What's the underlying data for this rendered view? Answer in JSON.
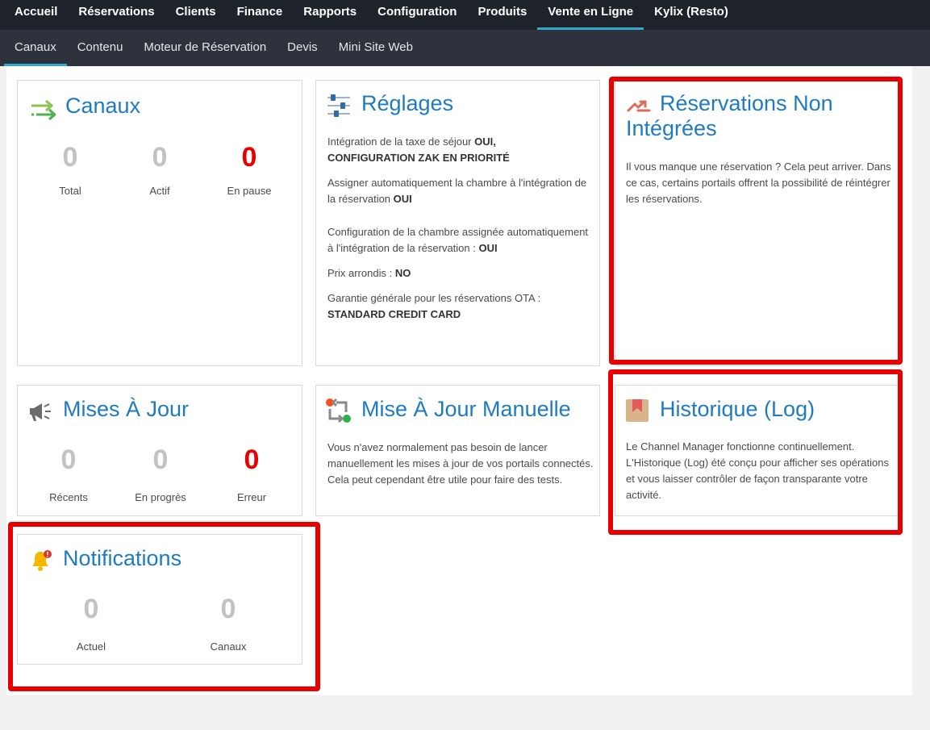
{
  "top_nav": [
    {
      "label": "Accueil",
      "active": false
    },
    {
      "label": "Réservations",
      "active": false
    },
    {
      "label": "Clients",
      "active": false
    },
    {
      "label": "Finance",
      "active": false
    },
    {
      "label": "Rapports",
      "active": false
    },
    {
      "label": "Configuration",
      "active": false
    },
    {
      "label": "Produits",
      "active": false
    },
    {
      "label": "Vente en Ligne",
      "active": true
    },
    {
      "label": "Kylix (Resto)",
      "active": false
    }
  ],
  "sub_nav": [
    {
      "label": "Canaux",
      "active": true
    },
    {
      "label": "Contenu",
      "active": false
    },
    {
      "label": "Moteur de Réservation",
      "active": false
    },
    {
      "label": "Devis",
      "active": false
    },
    {
      "label": "Mini Site Web",
      "active": false
    }
  ],
  "canaux": {
    "title": "Canaux",
    "icon": "arrows-transfer-icon",
    "stats": [
      {
        "value": "0",
        "label": "Total"
      },
      {
        "value": "0",
        "label": "Actif"
      },
      {
        "value": "0",
        "label": "En pause"
      }
    ]
  },
  "reglages": {
    "title": "Réglages",
    "icon": "sliders-icon",
    "settings": [
      {
        "text": "Intégration de la taxe de séjour ",
        "value": "OUI,",
        "value2": "CONFIGURATION ZAK EN PRIORITÉ"
      },
      {
        "text": "Assigner automatiquement la chambre à l'intégration de la réservation ",
        "value": "OUI"
      },
      {
        "text": "Configuration de la chambre assignée automatiquement à l'intégration de la réservation : ",
        "value": "OUI"
      },
      {
        "text": "Prix arrondis : ",
        "value": "NO"
      },
      {
        "text": "Garantie générale pour les réservations OTA : ",
        "value": "STANDARD CREDIT CARD"
      }
    ]
  },
  "non_integrees": {
    "title": "Réservations Non Intégrées",
    "icon": "redirect-arrow-icon",
    "text": "Il vous manque une réservation ? Cela peut arriver. Dans ce cas, certains portails offrent la possibilité de réintégrer les réservations."
  },
  "mises_a_jour": {
    "title": "Mises À Jour",
    "icon": "megaphone-icon",
    "stats": [
      {
        "value": "0",
        "label": "Récents"
      },
      {
        "value": "0",
        "label": "En progrès"
      },
      {
        "value": "0",
        "label": "Erreur"
      }
    ]
  },
  "mise_a_jour_manuelle": {
    "title": "Mise À Jour Manuelle",
    "icon": "manual-sync-icon",
    "text": "Vous n'avez normalement pas besoin de lancer manuellement les mises à jour de vos portails connectés. Cela peut cependant être utile pour faire des tests."
  },
  "historique": {
    "title": "Historique (Log)",
    "icon": "bookmark-icon",
    "text": "Le Channel Manager fonctionne continuellement. L'Historique (Log) été conçu pour afficher ses opérations et vous laisser contrôler de façon transparante votre activité."
  },
  "notifications": {
    "title": "Notifications",
    "icon": "bell-alert-icon",
    "stats": [
      {
        "value": "0",
        "label": "Actuel"
      },
      {
        "value": "0",
        "label": "Canaux"
      }
    ]
  },
  "colors": {
    "title_blue": "#1f7bc1",
    "error_red": "#e60000",
    "highlight_red": "#e80000",
    "nav_dark": "#1e222b",
    "subnav_dark": "#2d323c",
    "accent_cyan": "#33a9c7"
  }
}
